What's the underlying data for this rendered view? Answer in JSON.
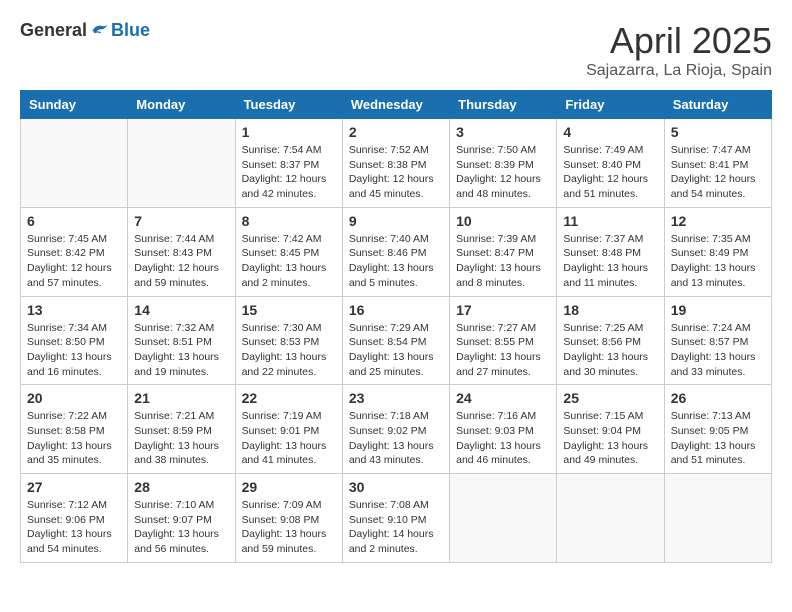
{
  "header": {
    "logo_general": "General",
    "logo_blue": "Blue",
    "month_title": "April 2025",
    "location": "Sajazarra, La Rioja, Spain"
  },
  "weekdays": [
    "Sunday",
    "Monday",
    "Tuesday",
    "Wednesday",
    "Thursday",
    "Friday",
    "Saturday"
  ],
  "weeks": [
    [
      {
        "day": "",
        "info": ""
      },
      {
        "day": "",
        "info": ""
      },
      {
        "day": "1",
        "info": "Sunrise: 7:54 AM\nSunset: 8:37 PM\nDaylight: 12 hours and 42 minutes."
      },
      {
        "day": "2",
        "info": "Sunrise: 7:52 AM\nSunset: 8:38 PM\nDaylight: 12 hours and 45 minutes."
      },
      {
        "day": "3",
        "info": "Sunrise: 7:50 AM\nSunset: 8:39 PM\nDaylight: 12 hours and 48 minutes."
      },
      {
        "day": "4",
        "info": "Sunrise: 7:49 AM\nSunset: 8:40 PM\nDaylight: 12 hours and 51 minutes."
      },
      {
        "day": "5",
        "info": "Sunrise: 7:47 AM\nSunset: 8:41 PM\nDaylight: 12 hours and 54 minutes."
      }
    ],
    [
      {
        "day": "6",
        "info": "Sunrise: 7:45 AM\nSunset: 8:42 PM\nDaylight: 12 hours and 57 minutes."
      },
      {
        "day": "7",
        "info": "Sunrise: 7:44 AM\nSunset: 8:43 PM\nDaylight: 12 hours and 59 minutes."
      },
      {
        "day": "8",
        "info": "Sunrise: 7:42 AM\nSunset: 8:45 PM\nDaylight: 13 hours and 2 minutes."
      },
      {
        "day": "9",
        "info": "Sunrise: 7:40 AM\nSunset: 8:46 PM\nDaylight: 13 hours and 5 minutes."
      },
      {
        "day": "10",
        "info": "Sunrise: 7:39 AM\nSunset: 8:47 PM\nDaylight: 13 hours and 8 minutes."
      },
      {
        "day": "11",
        "info": "Sunrise: 7:37 AM\nSunset: 8:48 PM\nDaylight: 13 hours and 11 minutes."
      },
      {
        "day": "12",
        "info": "Sunrise: 7:35 AM\nSunset: 8:49 PM\nDaylight: 13 hours and 13 minutes."
      }
    ],
    [
      {
        "day": "13",
        "info": "Sunrise: 7:34 AM\nSunset: 8:50 PM\nDaylight: 13 hours and 16 minutes."
      },
      {
        "day": "14",
        "info": "Sunrise: 7:32 AM\nSunset: 8:51 PM\nDaylight: 13 hours and 19 minutes."
      },
      {
        "day": "15",
        "info": "Sunrise: 7:30 AM\nSunset: 8:53 PM\nDaylight: 13 hours and 22 minutes."
      },
      {
        "day": "16",
        "info": "Sunrise: 7:29 AM\nSunset: 8:54 PM\nDaylight: 13 hours and 25 minutes."
      },
      {
        "day": "17",
        "info": "Sunrise: 7:27 AM\nSunset: 8:55 PM\nDaylight: 13 hours and 27 minutes."
      },
      {
        "day": "18",
        "info": "Sunrise: 7:25 AM\nSunset: 8:56 PM\nDaylight: 13 hours and 30 minutes."
      },
      {
        "day": "19",
        "info": "Sunrise: 7:24 AM\nSunset: 8:57 PM\nDaylight: 13 hours and 33 minutes."
      }
    ],
    [
      {
        "day": "20",
        "info": "Sunrise: 7:22 AM\nSunset: 8:58 PM\nDaylight: 13 hours and 35 minutes."
      },
      {
        "day": "21",
        "info": "Sunrise: 7:21 AM\nSunset: 8:59 PM\nDaylight: 13 hours and 38 minutes."
      },
      {
        "day": "22",
        "info": "Sunrise: 7:19 AM\nSunset: 9:01 PM\nDaylight: 13 hours and 41 minutes."
      },
      {
        "day": "23",
        "info": "Sunrise: 7:18 AM\nSunset: 9:02 PM\nDaylight: 13 hours and 43 minutes."
      },
      {
        "day": "24",
        "info": "Sunrise: 7:16 AM\nSunset: 9:03 PM\nDaylight: 13 hours and 46 minutes."
      },
      {
        "day": "25",
        "info": "Sunrise: 7:15 AM\nSunset: 9:04 PM\nDaylight: 13 hours and 49 minutes."
      },
      {
        "day": "26",
        "info": "Sunrise: 7:13 AM\nSunset: 9:05 PM\nDaylight: 13 hours and 51 minutes."
      }
    ],
    [
      {
        "day": "27",
        "info": "Sunrise: 7:12 AM\nSunset: 9:06 PM\nDaylight: 13 hours and 54 minutes."
      },
      {
        "day": "28",
        "info": "Sunrise: 7:10 AM\nSunset: 9:07 PM\nDaylight: 13 hours and 56 minutes."
      },
      {
        "day": "29",
        "info": "Sunrise: 7:09 AM\nSunset: 9:08 PM\nDaylight: 13 hours and 59 minutes."
      },
      {
        "day": "30",
        "info": "Sunrise: 7:08 AM\nSunset: 9:10 PM\nDaylight: 14 hours and 2 minutes."
      },
      {
        "day": "",
        "info": ""
      },
      {
        "day": "",
        "info": ""
      },
      {
        "day": "",
        "info": ""
      }
    ]
  ]
}
